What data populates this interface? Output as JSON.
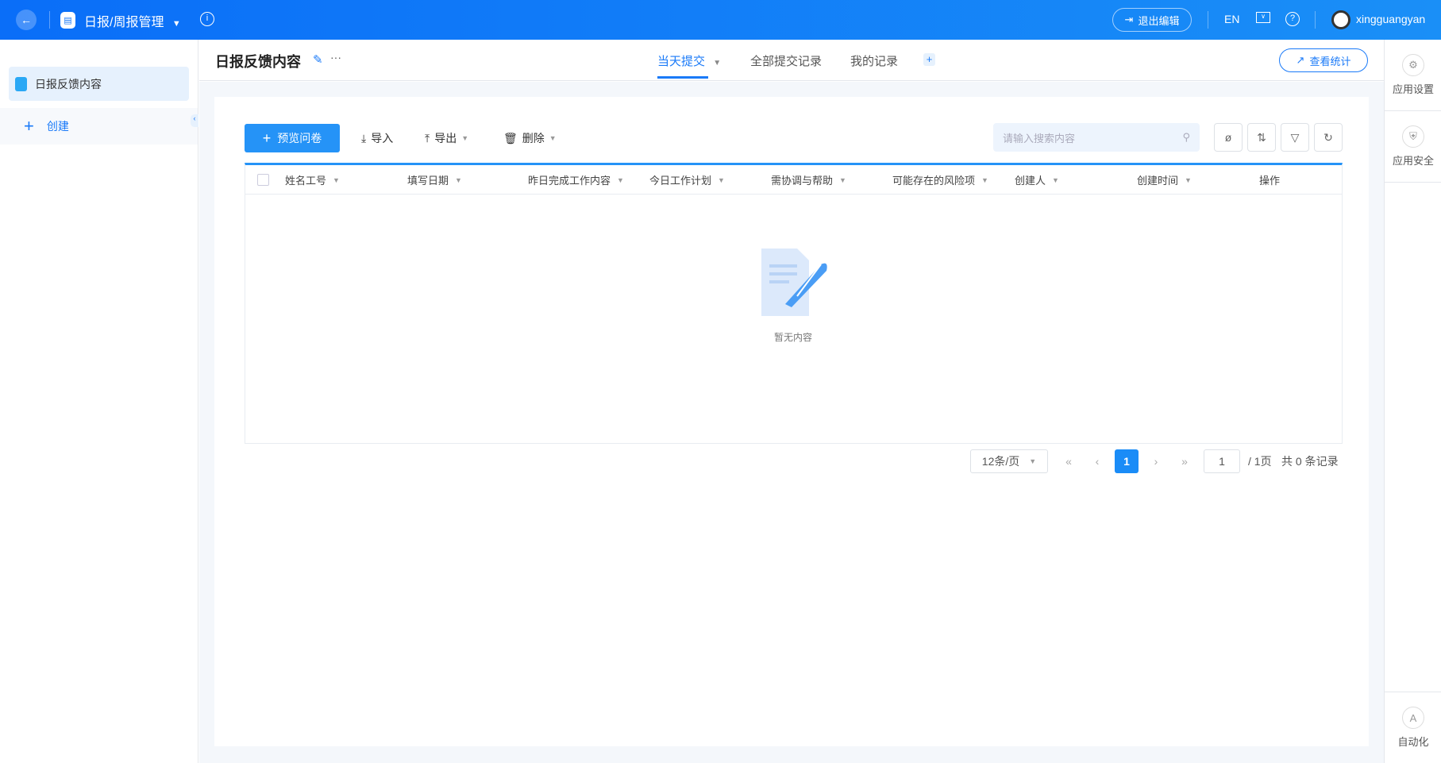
{
  "topbar": {
    "app_title": "日报/周报管理",
    "exit_edit": "退出编辑",
    "lang": "EN",
    "username": "xingguangyan"
  },
  "sidebar": {
    "items": [
      {
        "label": "日报反馈内容"
      }
    ],
    "create_label": "创建"
  },
  "page": {
    "title": "日报反馈内容",
    "tabs": [
      {
        "label": "当天提交",
        "active": true
      },
      {
        "label": "全部提交记录"
      },
      {
        "label": "我的记录"
      }
    ],
    "stats_button": "查看统计"
  },
  "toolbar": {
    "preview": "预览问卷",
    "import": "导入",
    "export": "导出",
    "delete": "删除",
    "search_placeholder": "请输入搜索内容"
  },
  "table": {
    "columns": [
      "姓名工号",
      "填写日期",
      "昨日完成工作内容",
      "今日工作计划",
      "需协调与帮助",
      "可能存在的风险项",
      "创建人",
      "创建时间",
      "操作"
    ],
    "rows": [],
    "empty_text": "暂无内容"
  },
  "pagination": {
    "page_size": "12条/页",
    "current_page": "1",
    "jump_value": "1",
    "total_pages": "/ 1页",
    "total_records": "共 0 条记录"
  },
  "rail": {
    "settings": "应用设置",
    "security": "应用安全",
    "automation": "自动化"
  },
  "colors": {
    "primary": "#1a7af8",
    "button": "#2593f7"
  }
}
